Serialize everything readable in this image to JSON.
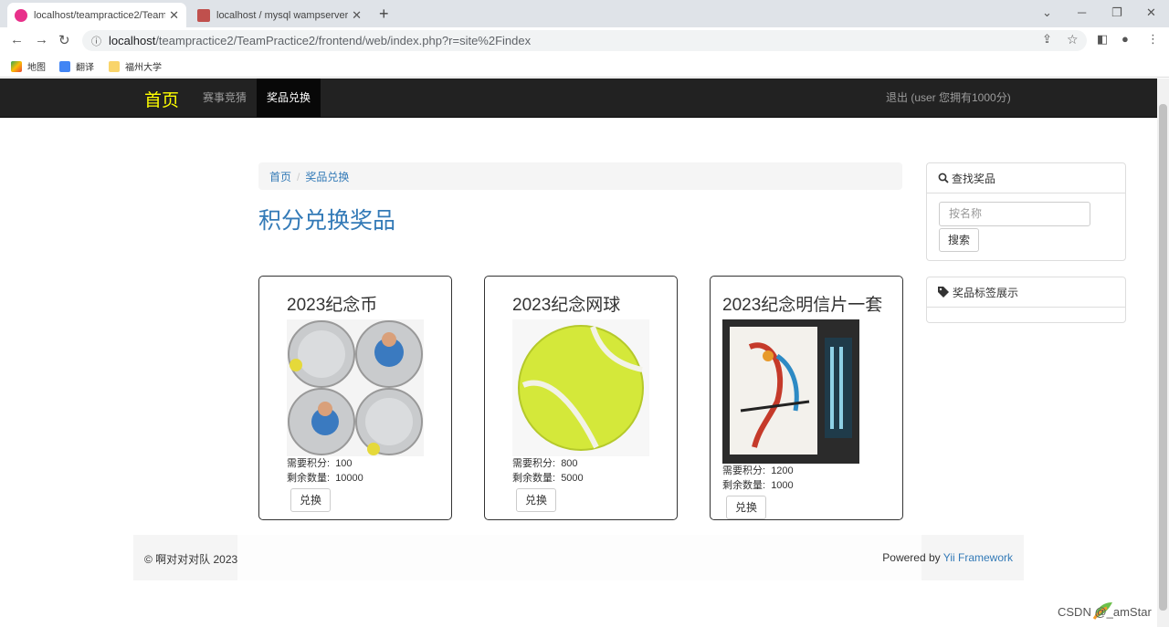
{
  "browser": {
    "tabs": [
      {
        "title": "localhost/teampractice2/Team",
        "active": true
      },
      {
        "title": "localhost / mysql wampserver",
        "active": false
      }
    ],
    "url_host": "localhost",
    "url_path": "/teampractice2/TeamPractice2/frontend/web/index.php?r=site%2Findex",
    "bookmarks": [
      "地图",
      "翻译",
      "福州大学"
    ]
  },
  "navbar": {
    "brand": "首页",
    "links": [
      {
        "label": "赛事竞猜",
        "active": false
      },
      {
        "label": "奖品兑换",
        "active": true
      }
    ],
    "logout": "退出 (user 您拥有1000分)"
  },
  "breadcrumb": {
    "home": "首页",
    "current": "奖品兑换"
  },
  "page_title": "积分兑换奖品",
  "prizes": [
    {
      "name": "2023纪念币",
      "points_label": "需要积分:",
      "points": "100",
      "stock_label": "剩余数量:",
      "stock": "10000",
      "button": "兑换",
      "image": "coin-image"
    },
    {
      "name": "2023纪念网球",
      "points_label": "需要积分:",
      "points": "800",
      "stock_label": "剩余数量:",
      "stock": "5000",
      "button": "兑换",
      "image": "tennis-ball-image"
    },
    {
      "name": "2023纪念明信片一套",
      "points_label": "需要积分:",
      "points": "1200",
      "stock_label": "剩余数量:",
      "stock": "1000",
      "button": "兑换",
      "image": "postcard-image"
    }
  ],
  "sidebar": {
    "search_title": "查找奖品",
    "search_placeholder": "按名称",
    "search_button": "搜索",
    "tags_title": "奖品标签展示"
  },
  "footer": {
    "left": "© 啊对对对队 2023",
    "right_prefix": "Powered by ",
    "right_link": "Yii Framework"
  },
  "watermark": "CSDN @_amStar",
  "colors": {
    "brand": "#ffff00",
    "link": "#337ab7",
    "navbar": "#222222"
  }
}
